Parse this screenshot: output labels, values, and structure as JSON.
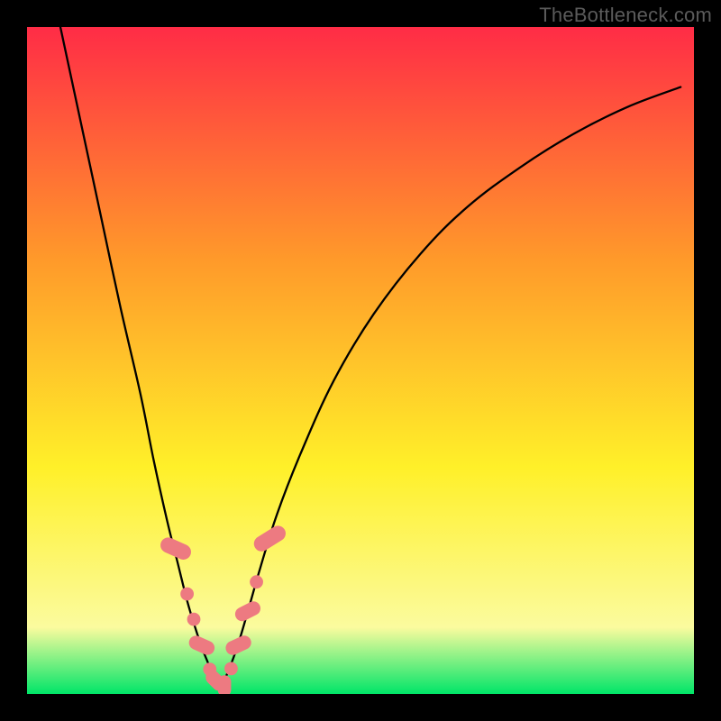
{
  "watermark": "TheBottleneck.com",
  "colors": {
    "red": "#ff2c46",
    "orange": "#ff9a2a",
    "yellow": "#fff029",
    "pale_yellow": "#fbfb9e",
    "green": "#00e568",
    "black": "#000000",
    "curve": "#000000",
    "marker_fill": "#ed7a81",
    "marker_stroke": "#ed7a81"
  },
  "chart_data": {
    "type": "line",
    "title": "",
    "xlabel": "",
    "ylabel": "",
    "xlim": [
      0,
      100
    ],
    "ylim": [
      0,
      100
    ],
    "series": [
      {
        "name": "left_branch",
        "x": [
          5,
          8,
          11,
          14,
          17,
          19,
          21,
          22.5,
          24,
          25.2,
          26.2,
          27,
          27.6,
          28.2,
          29
        ],
        "y": [
          100,
          86,
          72,
          58,
          45,
          35,
          26,
          20,
          14,
          10,
          7,
          5,
          3.5,
          2.5,
          1
        ]
      },
      {
        "name": "right_branch",
        "x": [
          29,
          30,
          31.5,
          33,
          35,
          37.5,
          41,
          46,
          52,
          59,
          66,
          74,
          82,
          90,
          98
        ],
        "y": [
          1,
          3,
          7,
          12,
          19,
          27,
          36,
          47,
          57,
          66,
          73,
          79,
          84,
          88,
          91
        ]
      }
    ],
    "markers": [
      {
        "shape": "pill",
        "cx": 22.3,
        "cy": 21.8,
        "rx": 1.15,
        "ry": 2.4,
        "angle": -66
      },
      {
        "shape": "circle",
        "cx": 24.0,
        "cy": 15.0,
        "r": 1.0
      },
      {
        "shape": "circle",
        "cx": 25.0,
        "cy": 11.2,
        "r": 1.0
      },
      {
        "shape": "pill",
        "cx": 26.2,
        "cy": 7.3,
        "rx": 1.05,
        "ry": 2.0,
        "angle": -66
      },
      {
        "shape": "circle",
        "cx": 27.4,
        "cy": 3.7,
        "r": 1.0
      },
      {
        "shape": "pill",
        "cx": 28.3,
        "cy": 2.0,
        "rx": 1.05,
        "ry": 1.7,
        "angle": -45
      },
      {
        "shape": "pill",
        "cx": 29.6,
        "cy": 1.2,
        "rx": 1.0,
        "ry": 1.6,
        "angle": 0
      },
      {
        "shape": "circle",
        "cx": 30.6,
        "cy": 3.8,
        "r": 1.0
      },
      {
        "shape": "pill",
        "cx": 31.7,
        "cy": 7.3,
        "rx": 1.05,
        "ry": 2.0,
        "angle": 65
      },
      {
        "shape": "pill",
        "cx": 33.1,
        "cy": 12.4,
        "rx": 1.05,
        "ry": 2.0,
        "angle": 63
      },
      {
        "shape": "circle",
        "cx": 34.4,
        "cy": 16.8,
        "r": 1.0
      },
      {
        "shape": "pill",
        "cx": 36.4,
        "cy": 23.3,
        "rx": 1.15,
        "ry": 2.6,
        "angle": 58
      }
    ]
  }
}
